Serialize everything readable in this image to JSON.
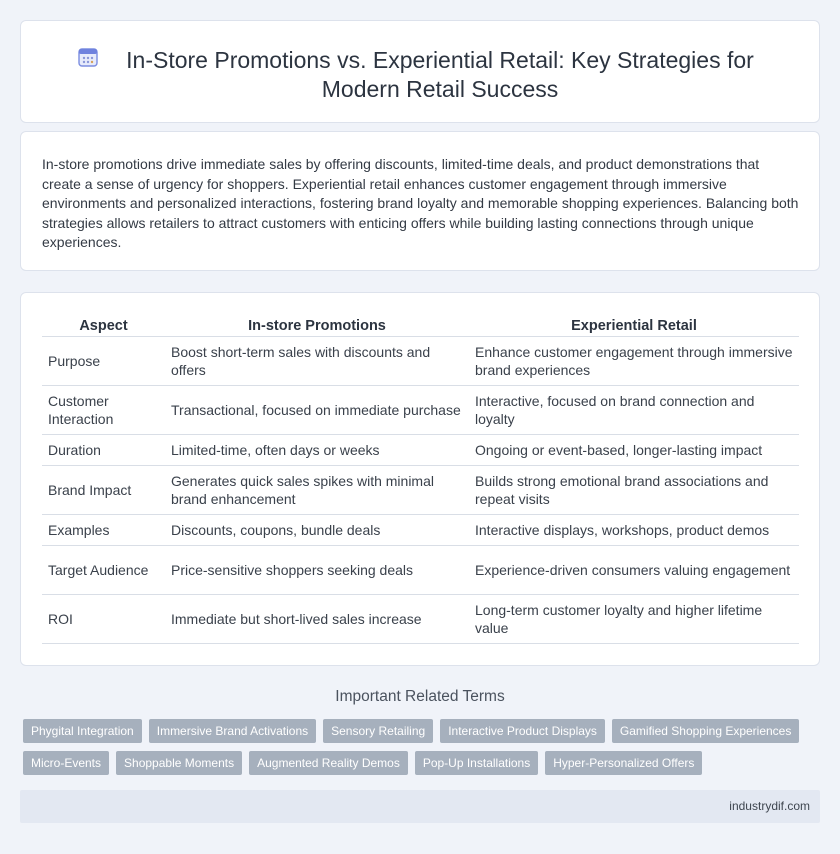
{
  "header": {
    "title": "In-Store Promotions vs. Experiential Retail: Key Strategies for Modern Retail Success",
    "icon": "calendar-icon",
    "icon_color": "#5b6fd6"
  },
  "intro": {
    "text": "In-store promotions drive immediate sales by offering discounts, limited-time deals, and product demonstrations that create a sense of urgency for shoppers. Experiential retail enhances customer engagement through immersive environments and personalized interactions, fostering brand loyalty and memorable shopping experiences. Balancing both strategies allows retailers to attract customers with enticing offers while building lasting connections through unique experiences."
  },
  "table": {
    "headers": [
      "Aspect",
      "In-store Promotions",
      "Experiential Retail"
    ],
    "rows": [
      [
        "Purpose",
        "Boost short-term sales with discounts and offers",
        "Enhance customer engagement through immersive brand experiences"
      ],
      [
        "Customer Interaction",
        "Transactional, focused on immediate purchase",
        "Interactive, focused on brand connection and loyalty"
      ],
      [
        "Duration",
        "Limited-time, often days or weeks",
        "Ongoing or event-based, longer-lasting impact"
      ],
      [
        "Brand Impact",
        "Generates quick sales spikes with minimal brand enhancement",
        "Builds strong emotional brand associations and repeat visits"
      ],
      [
        "Examples",
        "Discounts, coupons, bundle deals",
        "Interactive displays, workshops, product demos"
      ],
      [
        "Target Audience",
        "Price-sensitive shoppers seeking deals",
        "Experience-driven consumers valuing engagement"
      ],
      [
        "ROI",
        "Immediate but short-lived sales increase",
        "Long-term customer loyalty and higher lifetime value"
      ]
    ]
  },
  "related": {
    "title": "Important Related Terms",
    "tags_row1": [
      "Phygital Integration",
      "Immersive Brand Activations",
      "Sensory Retailing",
      "Interactive Product Displays",
      "Gamified Shopping Experiences"
    ],
    "tags_row2": [
      "Micro-Events",
      "Shoppable Moments",
      "Augmented Reality Demos",
      "Pop-Up Installations",
      "Hyper-Personalized Offers"
    ]
  },
  "footer": {
    "site": "industrydif.com"
  }
}
